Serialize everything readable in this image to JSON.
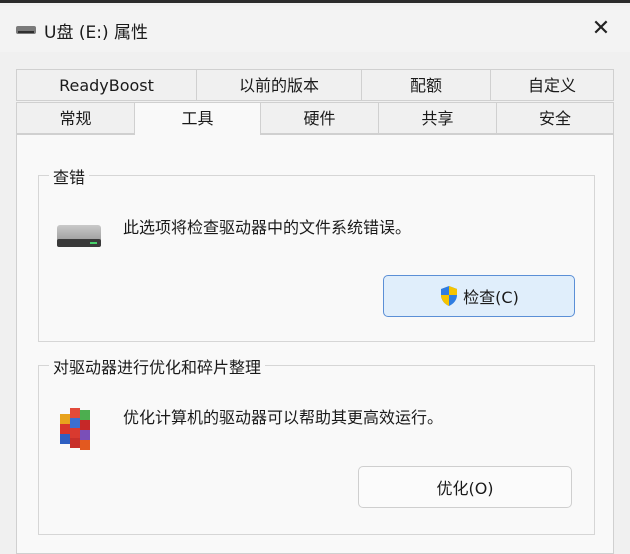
{
  "window": {
    "title": "U盘 (E:) 属性",
    "close_glyph": "✕"
  },
  "tabs": {
    "back": [
      "ReadyBoost",
      "以前的版本",
      "配额",
      "自定义"
    ],
    "front": [
      "常规",
      "工具",
      "硬件",
      "共享",
      "安全"
    ],
    "selected": "工具"
  },
  "check_group": {
    "title": "查错",
    "description": "此选项将检查驱动器中的文件系统错误。",
    "icon": "drive-icon",
    "button_label": "检查(C)",
    "button_icon": "uac-shield-icon"
  },
  "optimize_group": {
    "title": "对驱动器进行优化和碎片整理",
    "description": "优化计算机的驱动器可以帮助其更高效运行。",
    "icon": "defrag-icon",
    "button_label": "优化(O)"
  }
}
